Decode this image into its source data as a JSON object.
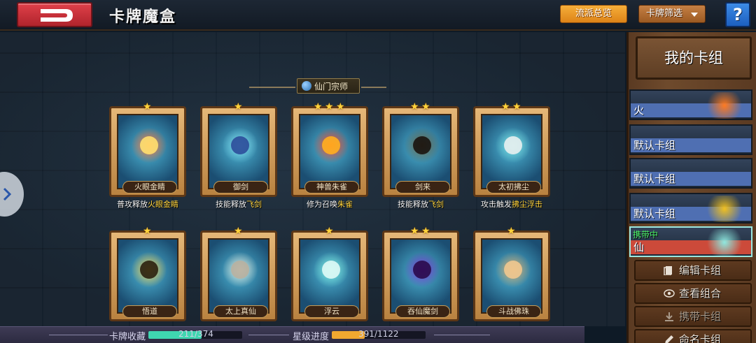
{
  "header": {
    "title": "卡牌魔盒",
    "overview_label": "流派总览",
    "filter_label": "卡牌筛选",
    "help_label": "?"
  },
  "school_label": "仙门宗师",
  "cards": [
    {
      "name": "火眼金睛",
      "stars": 1,
      "desc_pre": "普攻释放",
      "desc_hl": "火眼金睛",
      "hl": "hl",
      "art": "#ff6a2a",
      "art2": "#ffe070"
    },
    {
      "name": "御剑",
      "stars": 1,
      "desc_pre": "技能释放",
      "desc_hl": "飞剑",
      "hl": "hl",
      "art": "#7fd6e6",
      "art2": "#2c4c9a"
    },
    {
      "name": "神兽朱雀",
      "stars": 3,
      "desc_pre": "修为召唤",
      "desc_hl": "朱雀",
      "hl": "hl",
      "art": "#ff3a1a",
      "art2": "#ffb020"
    },
    {
      "name": "剑来",
      "stars": 2,
      "desc_pre": "技能释放",
      "desc_hl": "飞剑",
      "hl": "hl",
      "art": "#6a5a3a",
      "art2": "#1a1410"
    },
    {
      "name": "太初拂尘",
      "stars": 2,
      "desc_pre": "攻击触发",
      "desc_hl": "拂尘浮击",
      "hl": "hl",
      "art": "#7adada",
      "art2": "#e8f0f0"
    },
    {
      "name": "悟道",
      "stars": 1,
      "desc_pre": "",
      "desc_hl": "",
      "hl": "hl",
      "art": "#f2c84a",
      "art2": "#2a2010"
    },
    {
      "name": "太上真仙",
      "stars": 1,
      "desc_pre": "",
      "desc_hl": "",
      "hl": "hl",
      "art": "#e8e4d4",
      "art2": "#b8b0a0"
    },
    {
      "name": "浮云",
      "stars": 1,
      "desc_pre": "",
      "desc_hl": "",
      "hl": "hl",
      "art": "#7ee6d8",
      "art2": "#dffaf6"
    },
    {
      "name": "吞仙魔剑",
      "stars": 2,
      "desc_pre": "",
      "desc_hl": "",
      "hl": "hl",
      "art": "#7a2ac8",
      "art2": "#2a0a4a"
    },
    {
      "name": "斗战佛珠",
      "stars": 1,
      "desc_pre": "",
      "desc_hl": "",
      "hl": "hl",
      "art": "#d8a060",
      "art2": "#f0c890"
    }
  ],
  "sidebar": {
    "title": "我的卡组",
    "decks": [
      {
        "label": "火",
        "deco": "#ff7a20"
      },
      {
        "label": "默认卡组",
        "deco": ""
      },
      {
        "label": "默认卡组",
        "deco": ""
      },
      {
        "label": "默认卡组",
        "deco": "#f0c020"
      },
      {
        "label": "仙",
        "carry": "携带中",
        "deco": "#8ee8e0"
      }
    ],
    "actions": [
      {
        "label": "编辑卡组",
        "icon": "edit-icon"
      },
      {
        "label": "查看组合",
        "icon": "eye-icon"
      },
      {
        "label": "携带卡组",
        "icon": "download-icon"
      },
      {
        "label": "命名卡组",
        "icon": "pencil-icon"
      }
    ]
  },
  "footer": {
    "collection_label": "卡牌收藏",
    "collection_value": "211/374",
    "collection_ratio": 0.564,
    "star_label": "星级进度",
    "star_value": "391/1122",
    "star_ratio": 0.348
  },
  "colors": {
    "accent": "#f6ae3a",
    "collection_fill": "#3fd6b0",
    "star_fill": "#f0a830"
  }
}
